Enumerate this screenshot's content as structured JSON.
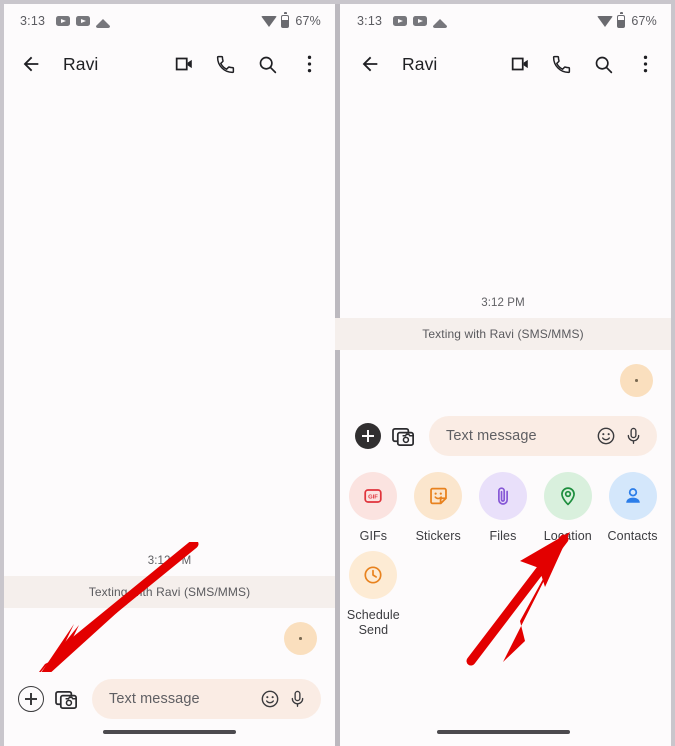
{
  "meta": {
    "app": "Google Messages",
    "accent_red": "#e30000",
    "bubble_color": "#fadfbe",
    "input_pill_color": "#faece4",
    "banner_color": "#f5efec"
  },
  "status_bar": {
    "time": "3:13",
    "battery_percent": "67%",
    "left_icons": [
      "youtube-icon",
      "youtube-icon",
      "cloud-upload-icon"
    ],
    "right_icons": [
      "wifi-icon",
      "battery-icon"
    ]
  },
  "app_bar": {
    "back_icon": "back-arrow-icon",
    "title": "Ravi",
    "actions": [
      {
        "name": "video-call-icon",
        "label": "Video call"
      },
      {
        "name": "phone-call-icon",
        "label": "Call"
      },
      {
        "name": "search-icon",
        "label": "Search"
      },
      {
        "name": "overflow-menu-icon",
        "label": "More options"
      }
    ]
  },
  "conversation": {
    "timestamp": "3:12 PM",
    "sms_banner": "Texting with Ravi (SMS/MMS)"
  },
  "composer": {
    "plus_label": "+",
    "gallery_label": "Gallery",
    "placeholder": "Text message",
    "value": "",
    "emoji_icon": "emoji-icon",
    "mic_icon": "microphone-icon"
  },
  "attachments": [
    {
      "label": "GIFs",
      "icon": "gif-icon",
      "circle": "#fbe3e0",
      "color": "#e0333b"
    },
    {
      "label": "Stickers",
      "icon": "sticker-icon",
      "circle": "#fbe6cd",
      "color": "#e8821e"
    },
    {
      "label": "Files",
      "icon": "paperclip-icon",
      "circle": "#e9e0fa",
      "color": "#8657d6"
    },
    {
      "label": "Location",
      "icon": "location-pin-icon",
      "circle": "#d9f0dd",
      "color": "#1e8e3e"
    },
    {
      "label": "Contacts",
      "icon": "contact-icon",
      "circle": "#d4e7fb",
      "color": "#2b7de9"
    },
    {
      "label": "Schedule\nSend",
      "icon": "clock-icon",
      "circle": "#fdebd4",
      "color": "#e8821e"
    }
  ],
  "panels": {
    "left": {
      "name": "messages-composer-collapsed",
      "plus_state": "outlined"
    },
    "right": {
      "name": "messages-attachment-menu-open",
      "plus_state": "filled"
    }
  },
  "annotations": [
    {
      "name": "arrow-to-plus-button",
      "target": "plus-button",
      "panel": "left"
    },
    {
      "name": "arrow-to-location-option",
      "target": "Location",
      "panel": "right"
    }
  ]
}
